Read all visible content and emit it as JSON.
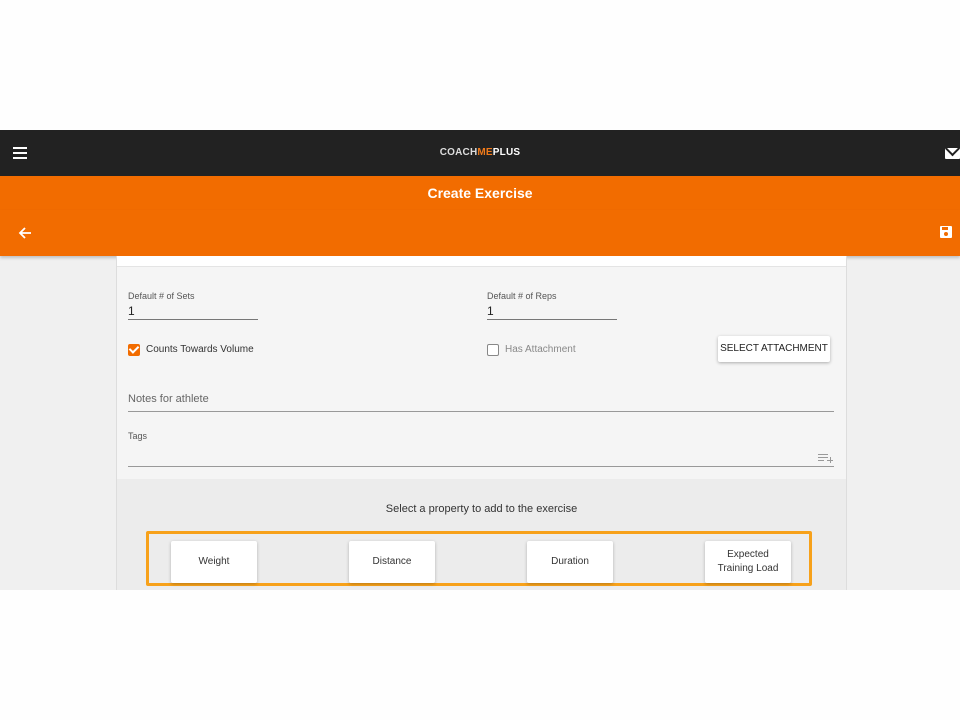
{
  "app": {
    "logo": {
      "part1": "COACH",
      "part2": "ME",
      "part3": "PLUS"
    },
    "title": "Create Exercise"
  },
  "form": {
    "sets": {
      "label": "Default # of Sets",
      "value": "1"
    },
    "reps": {
      "label": "Default # of Reps",
      "value": "1"
    },
    "counts_towards_volume": {
      "label": "Counts Towards Volume",
      "checked": true
    },
    "has_attachment": {
      "label": "Has Attachment",
      "checked": false
    },
    "select_attachment_label": "SELECT ATTACHMENT",
    "notes_placeholder": "Notes for athlete",
    "tags_label": "Tags"
  },
  "properties": {
    "prompt": "Select a property to add to the exercise",
    "items": [
      {
        "label": "Weight"
      },
      {
        "label": "Distance"
      },
      {
        "label": "Duration"
      },
      {
        "label": "Expected Training Load"
      }
    ]
  },
  "colors": {
    "accent": "#f26c00",
    "topbar": "#222222",
    "highlight": "#f7a11a"
  },
  "icons": [
    "menu-icon",
    "mail-icon",
    "back-arrow-icon",
    "save-icon",
    "playlist-add-icon"
  ]
}
